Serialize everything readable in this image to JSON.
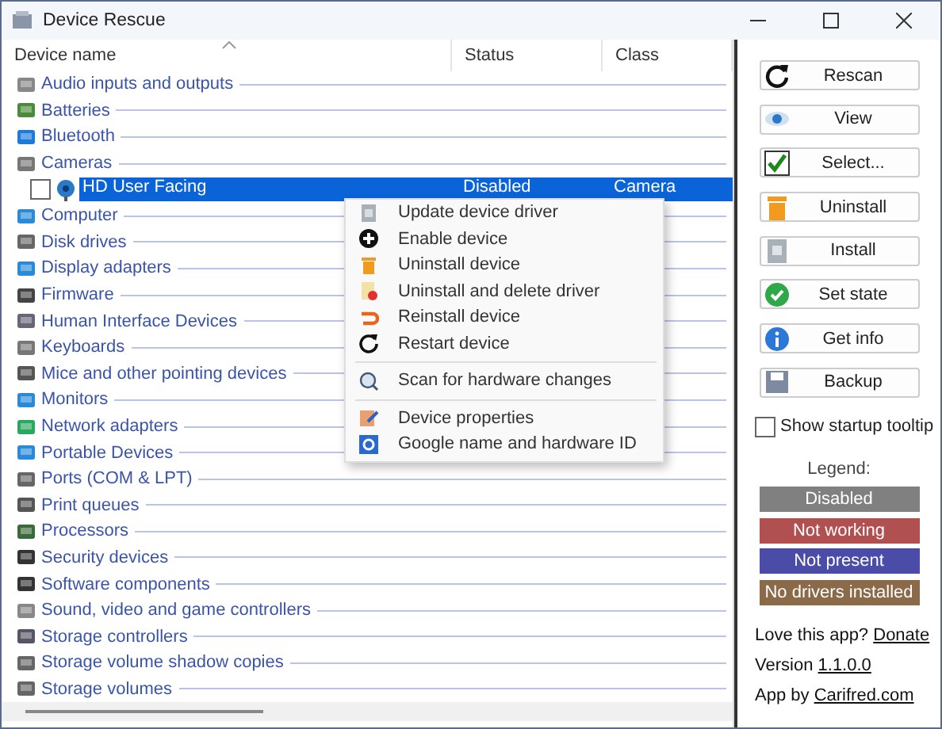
{
  "window": {
    "title": "Device Rescue"
  },
  "table": {
    "columns": [
      {
        "label": "Device name",
        "sorted": true
      },
      {
        "label": "Status",
        "sorted": false
      },
      {
        "label": "Class",
        "sorted": false
      }
    ],
    "rows": [
      {
        "name": "Audio inputs and outputs",
        "children": []
      },
      {
        "name": "Batteries",
        "children": []
      },
      {
        "name": "Bluetooth",
        "children": []
      },
      {
        "name": "Cameras",
        "children": [
          {
            "name": "HD User Facing",
            "status": "Disabled",
            "class": "Camera",
            "checked": false,
            "selected": true
          }
        ]
      },
      {
        "name": "Computer",
        "children": []
      },
      {
        "name": "Disk drives",
        "children": []
      },
      {
        "name": "Display adapters",
        "children": []
      },
      {
        "name": "Firmware",
        "children": []
      },
      {
        "name": "Human Interface Devices",
        "children": []
      },
      {
        "name": "Keyboards",
        "children": []
      },
      {
        "name": "Mice and other pointing devices",
        "children": []
      },
      {
        "name": "Monitors",
        "children": []
      },
      {
        "name": "Network adapters",
        "children": []
      },
      {
        "name": "Portable Devices",
        "children": []
      },
      {
        "name": "Ports (COM & LPT)",
        "children": []
      },
      {
        "name": "Print queues",
        "children": []
      },
      {
        "name": "Processors",
        "children": []
      },
      {
        "name": "Security devices",
        "children": []
      },
      {
        "name": "Software components",
        "children": []
      },
      {
        "name": "Sound, video and game controllers",
        "children": []
      },
      {
        "name": "Storage controllers",
        "children": []
      },
      {
        "name": "Storage volume shadow copies",
        "children": []
      },
      {
        "name": "Storage volumes",
        "children": []
      }
    ]
  },
  "context_menu": {
    "groups": [
      [
        "Update device driver",
        "Enable device",
        "Uninstall device",
        "Uninstall and delete driver",
        "Reinstall device",
        "Restart device"
      ],
      [
        "Scan for hardware changes"
      ],
      [
        "Device properties",
        "Google name and hardware ID"
      ]
    ]
  },
  "actions": [
    "Rescan",
    "View",
    "Select...",
    "Uninstall",
    "Install",
    "Set state",
    "Get info",
    "Backup"
  ],
  "startup_tooltip": {
    "label": "Show startup tooltip",
    "checked": false
  },
  "legend": {
    "title": "Legend:",
    "items": [
      {
        "label": "Disabled",
        "color": "#808080"
      },
      {
        "label": "Not working",
        "color": "#b05050"
      },
      {
        "label": "Not present",
        "color": "#4b4ba8"
      },
      {
        "label": "No drivers installed",
        "color": "#8b6a4a"
      }
    ]
  },
  "footer": [
    {
      "text": "Love this app?",
      "link": "Donate"
    },
    {
      "text": "Version",
      "link": "1.1.0.0"
    },
    {
      "text": "App by",
      "link": "Carifred.com"
    }
  ]
}
